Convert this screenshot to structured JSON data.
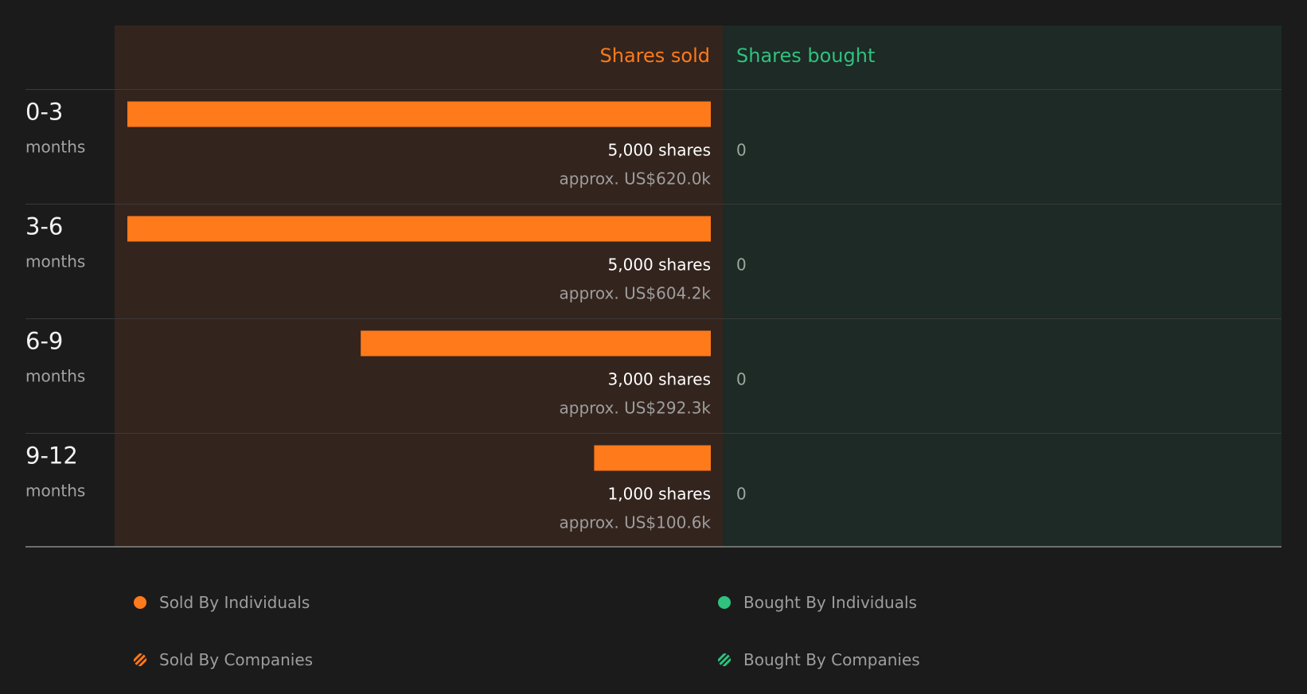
{
  "chart_data": {
    "type": "bar",
    "orientation": "horizontal",
    "columns": {
      "sold": "Shares sold",
      "bought": "Shares bought"
    },
    "rows": [
      {
        "period": "0-3",
        "unit": "months",
        "sold_shares": 5000,
        "sold_label": "5,000 shares",
        "sold_value_label": "approx. US$620.0k",
        "bought_shares": 0,
        "bought_label": "0"
      },
      {
        "period": "3-6",
        "unit": "months",
        "sold_shares": 5000,
        "sold_label": "5,000 shares",
        "sold_value_label": "approx. US$604.2k",
        "bought_shares": 0,
        "bought_label": "0"
      },
      {
        "period": "6-9",
        "unit": "months",
        "sold_shares": 3000,
        "sold_label": "3,000 shares",
        "sold_value_label": "approx. US$292.3k",
        "bought_shares": 0,
        "bought_label": "0"
      },
      {
        "period": "9-12",
        "unit": "months",
        "sold_shares": 1000,
        "sold_label": "1,000 shares",
        "sold_value_label": "approx. US$100.6k",
        "bought_shares": 0,
        "bought_label": "0"
      }
    ],
    "xlim": [
      0,
      5000
    ],
    "legend": {
      "placement": "bottom",
      "items": [
        {
          "label": "Sold By Individuals",
          "marker": "dot",
          "color": "#ff7a1a"
        },
        {
          "label": "Bought By Individuals",
          "marker": "dot",
          "color": "#2ec27e"
        },
        {
          "label": "Sold By Companies",
          "marker": "striped-dot",
          "color": "#ff7a1a"
        },
        {
          "label": "Bought By Companies",
          "marker": "striped-dot",
          "color": "#2ec27e"
        }
      ]
    }
  },
  "colors": {
    "background": "#1b1b1b",
    "sold_panel": "#33241d",
    "bought_panel": "#1d2a25",
    "sold_accent": "#ff7a1a",
    "bought_accent": "#2ec27e",
    "divider": "#3a3a3a",
    "baseline": "#8a8a8a"
  }
}
